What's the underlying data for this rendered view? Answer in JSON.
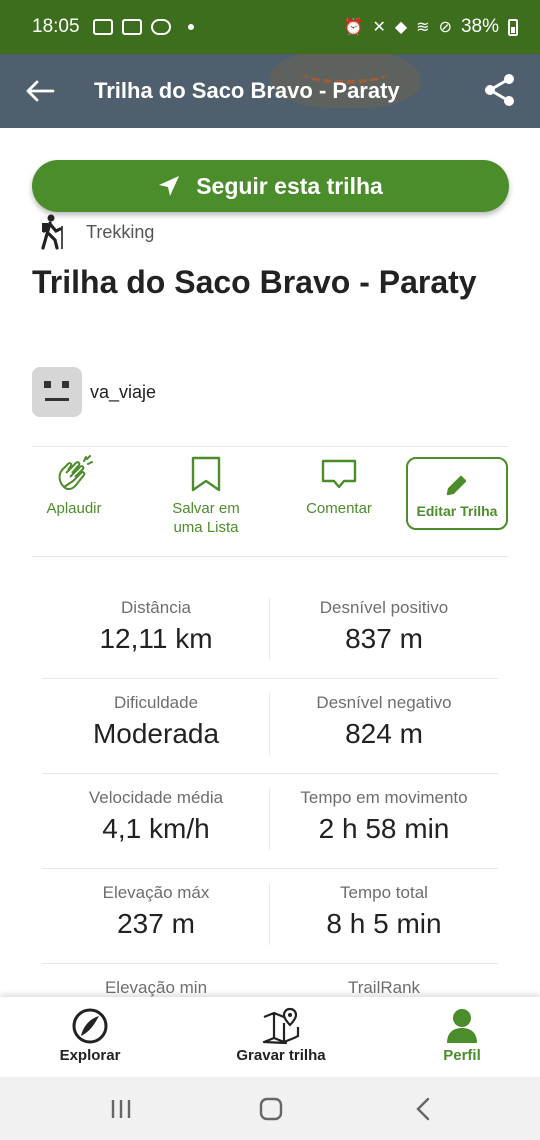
{
  "status_bar": {
    "time": "18:05",
    "battery": "38%"
  },
  "app_bar": {
    "title": "Trilha do Saco Bravo - Paraty"
  },
  "follow_button": {
    "label": "Seguir esta trilha"
  },
  "activity": {
    "type": "Trekking"
  },
  "trail": {
    "title": "Trilha do Saco Bravo - Paraty"
  },
  "author": {
    "username": "va_viaje"
  },
  "actions": {
    "applaud": "Aplaudir",
    "save_line1": "Salvar em",
    "save_line2": "uma Lista",
    "comment": "Comentar",
    "edit": "Editar Trilha"
  },
  "stats": [
    {
      "left_label": "Distância",
      "left_value": "12,11 km",
      "right_label": "Desnível positivo",
      "right_value": "837 m"
    },
    {
      "left_label": "Dificuldade",
      "left_value": "Moderada",
      "right_label": "Desnível negativo",
      "right_value": "824 m"
    },
    {
      "left_label": "Velocidade média",
      "left_value": "4,1 km/h",
      "right_label": "Tempo em movimento",
      "right_value": "2 h 58 min"
    },
    {
      "left_label": "Elevação máx",
      "left_value": "237 m",
      "right_label": "Tempo total",
      "right_value": "8 h 5 min"
    },
    {
      "left_label": "Elevação min",
      "left_value": "",
      "right_label": "TrailRank",
      "right_value": ""
    }
  ],
  "bottom_nav": {
    "explore": "Explorar",
    "record": "Gravar trilha",
    "profile": "Perfil"
  },
  "colors": {
    "brand_green": "#4c8d2b",
    "status_green": "#3d6e1e",
    "app_bar": "#4f5f6d"
  },
  "icons": [
    "back-arrow-icon",
    "share-icon",
    "navigation-arrow-icon",
    "hiker-icon",
    "clap-icon",
    "bookmark-icon",
    "comment-icon",
    "pencil-icon",
    "explore-icon",
    "map-pin-icon",
    "profile-icon"
  ]
}
